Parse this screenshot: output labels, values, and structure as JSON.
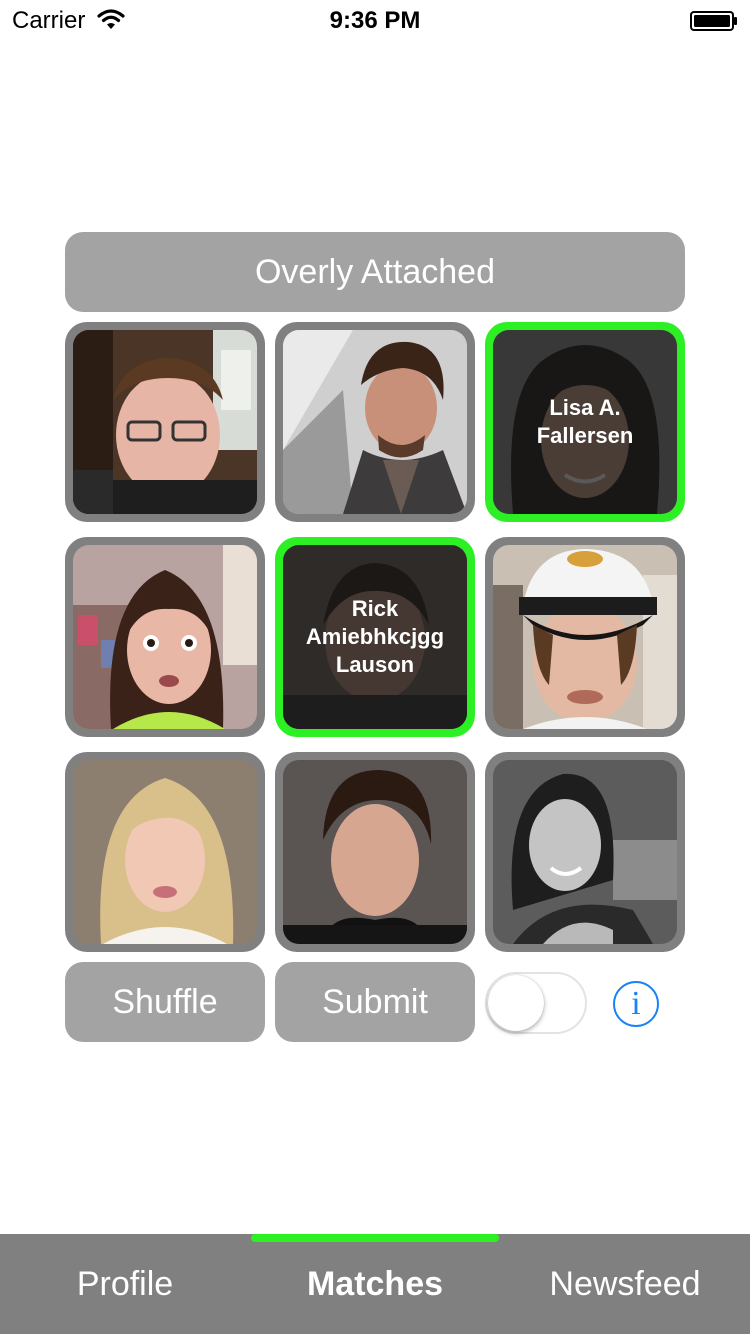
{
  "status_bar": {
    "carrier": "Carrier",
    "time": "9:36 PM"
  },
  "header": {
    "title": "Overly Attached"
  },
  "grid": [
    {
      "selected": false,
      "name": "",
      "icon": "photo-young-man-glasses"
    },
    {
      "selected": false,
      "name": "",
      "icon": "photo-man-looking-up"
    },
    {
      "selected": true,
      "name": "Lisa A. Fallersen",
      "icon": "photo-woman-dark-hair"
    },
    {
      "selected": false,
      "name": "",
      "icon": "photo-overly-attached-girlfriend"
    },
    {
      "selected": true,
      "name": "Rick Amiebhkcjgg Lauson",
      "icon": "photo-man-dark"
    },
    {
      "selected": false,
      "name": "",
      "icon": "photo-man-captain-hat"
    },
    {
      "selected": false,
      "name": "",
      "icon": "photo-blonde-woman"
    },
    {
      "selected": false,
      "name": "",
      "icon": "photo-man-curly-hair"
    },
    {
      "selected": false,
      "name": "",
      "icon": "photo-woman-bw"
    }
  ],
  "actions": {
    "shuffle": "Shuffle",
    "submit": "Submit",
    "toggle_on": false,
    "info_icon": "info-icon"
  },
  "tabs": [
    {
      "label": "Profile",
      "active": false
    },
    {
      "label": "Matches",
      "active": true
    },
    {
      "label": "Newsfeed",
      "active": false
    }
  ],
  "colors": {
    "accent": "#2df024",
    "button": "#a3a3a3",
    "tile_border": "#808080",
    "info": "#1a82f7"
  }
}
